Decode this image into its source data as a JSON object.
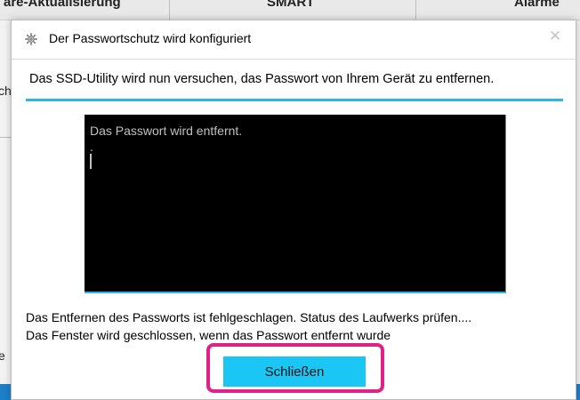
{
  "background": {
    "columns": [
      "are-Aktualisierung",
      "SMART",
      "Alarme"
    ],
    "left_fragments": [
      "ch",
      "e"
    ]
  },
  "dialog": {
    "title": "Der Passwortschutz wird konfiguriert",
    "title_icon": "gear-icon",
    "close_glyph": "✕",
    "message": "Das SSD-Utility wird nun versuchen, das Passwort von Ihrem Gerät zu entfernen.",
    "console": {
      "line1": "Das Passwort wird entfernt.",
      "line2": "."
    },
    "status_lines": [
      "Das Entfernen des Passworts ist fehlgeschlagen. Status des Laufwerks prüfen....",
      "Das Fenster wird geschlossen, wenn das Passwort entfernt wurde"
    ],
    "close_button_label": "Schließen"
  },
  "colors": {
    "accent": "#2ab6ec",
    "button": "#1ac6f4",
    "highlight": "#e0218a",
    "console_bg": "#000000"
  }
}
